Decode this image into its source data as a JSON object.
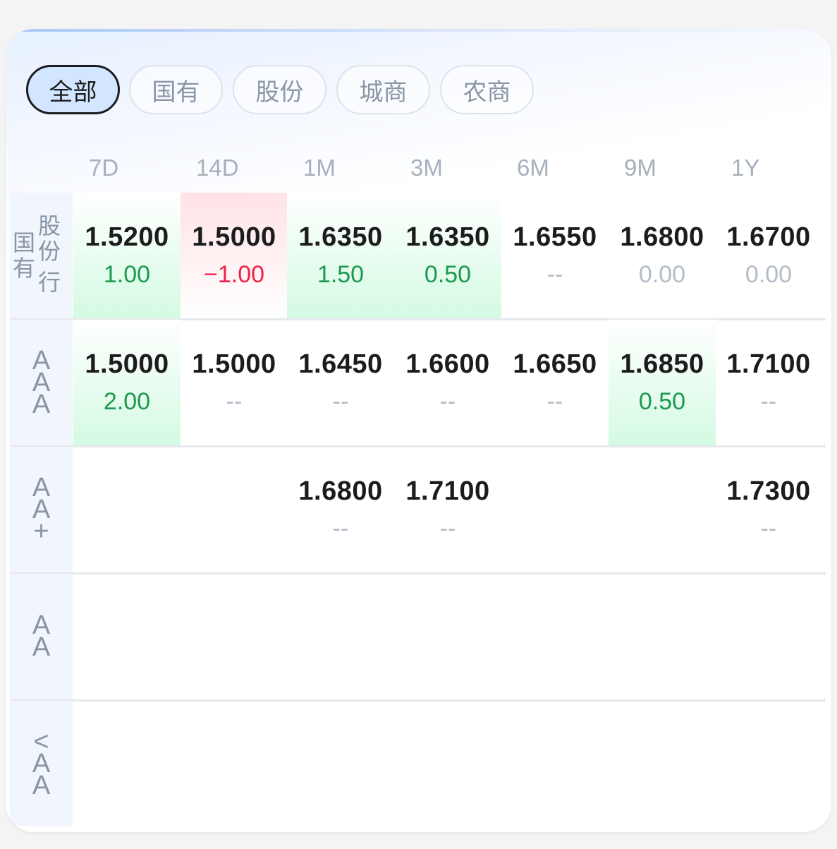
{
  "tabs": [
    {
      "label": "全部",
      "active": true
    },
    {
      "label": "国有",
      "active": false
    },
    {
      "label": "股份",
      "active": false
    },
    {
      "label": "城商",
      "active": false
    },
    {
      "label": "农商",
      "active": false
    }
  ],
  "table": {
    "columns": [
      "7D",
      "14D",
      "1M",
      "3M",
      "6M",
      "9M",
      "1Y"
    ],
    "rows": [
      {
        "label": "国有股份行",
        "label_chars": [
          "股",
          "国",
          "份",
          "有",
          "行"
        ],
        "cells": [
          {
            "value": "1.5200",
            "change": "1.00",
            "trend": "up"
          },
          {
            "value": "1.5000",
            "change": "−1.00",
            "trend": "down"
          },
          {
            "value": "1.6350",
            "change": "1.50",
            "trend": "up"
          },
          {
            "value": "1.6350",
            "change": "0.50",
            "trend": "up"
          },
          {
            "value": "1.6550",
            "change": "--",
            "trend": "none"
          },
          {
            "value": "1.6800",
            "change": "0.00",
            "trend": "flat"
          },
          {
            "value": "1.6700",
            "change": "0.00",
            "trend": "flat"
          }
        ]
      },
      {
        "label": "AAA",
        "label_chars": [
          "A",
          "A",
          "A"
        ],
        "cells": [
          {
            "value": "1.5000",
            "change": "2.00",
            "trend": "up"
          },
          {
            "value": "1.5000",
            "change": "--",
            "trend": "none"
          },
          {
            "value": "1.6450",
            "change": "--",
            "trend": "none"
          },
          {
            "value": "1.6600",
            "change": "--",
            "trend": "none"
          },
          {
            "value": "1.6650",
            "change": "--",
            "trend": "none"
          },
          {
            "value": "1.6850",
            "change": "0.50",
            "trend": "up"
          },
          {
            "value": "1.7100",
            "change": "--",
            "trend": "none"
          }
        ]
      },
      {
        "label": "AA+",
        "label_chars": [
          "A",
          "A",
          "+"
        ],
        "cells": [
          null,
          null,
          {
            "value": "1.6800",
            "change": "--",
            "trend": "none"
          },
          {
            "value": "1.7100",
            "change": "--",
            "trend": "none"
          },
          null,
          null,
          {
            "value": "1.7300",
            "change": "--",
            "trend": "none"
          }
        ]
      },
      {
        "label": "AA",
        "label_chars": [
          "A",
          "A"
        ],
        "cells": [
          null,
          null,
          null,
          null,
          null,
          null,
          null
        ]
      },
      {
        "label": "<AA",
        "label_chars": [
          "<",
          "A",
          "A"
        ],
        "cells": [
          null,
          null,
          null,
          null,
          null,
          null,
          null
        ]
      }
    ]
  },
  "colors": {
    "up": "#1a9a4e",
    "down": "#ee2248",
    "neutral": "#b3bcc7",
    "active_tab_bg": "#d3e6ff"
  }
}
